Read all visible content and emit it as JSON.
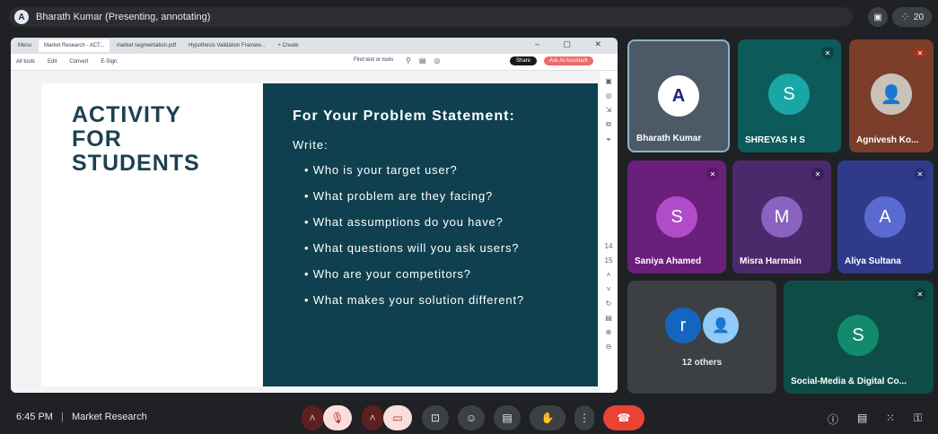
{
  "presenter_bar": {
    "label": "Bharath Kumar (Presenting, annotating)",
    "participant_count": "20"
  },
  "browser": {
    "tabs": [
      "Menu",
      "Market Research - ACT...",
      "market segmentation.pdf",
      "Hypothesis Validation Framew...",
      "+ Create"
    ],
    "toolbar": [
      "All tools",
      "Edit",
      "Convert",
      "E-Sign"
    ],
    "find_label": "Find text or tools",
    "share_label": "Share",
    "ai_label": "Ask AI Assistant"
  },
  "slide": {
    "left_title_lines": [
      "ACTIVITY",
      "FOR",
      "STUDENTS"
    ],
    "heading": "For Your Problem Statement:",
    "write_label": "Write:",
    "bullets": [
      "Who is your target user?",
      "What problem are they facing?",
      "What assumptions do you have?",
      "What questions will you ask users?",
      "Who are your competitors?",
      "What makes your solution different?"
    ],
    "page_indicator": "14",
    "page_total": "15"
  },
  "participants": [
    {
      "name": "Bharath Kumar",
      "initial": "A"
    },
    {
      "name": "SHREYAS H S",
      "initial": "S"
    },
    {
      "name": "Agnivesh Ko...",
      "initial": ""
    },
    {
      "name": "Saniya Ahamed",
      "initial": "S"
    },
    {
      "name": "Misra Harmain",
      "initial": "M"
    },
    {
      "name": "Aliya Sultana",
      "initial": "A"
    },
    {
      "name": "Social-Media & Digital Co...",
      "initial": "S"
    }
  ],
  "others_tile": {
    "label": "12 others",
    "initial": "r"
  },
  "meeting": {
    "time": "6:45 PM",
    "separator": "|",
    "title": "Market Research"
  },
  "colors": {
    "end_call": "#ea4335",
    "slide_dark": "#10404f",
    "mute_red": "#b3261e"
  }
}
